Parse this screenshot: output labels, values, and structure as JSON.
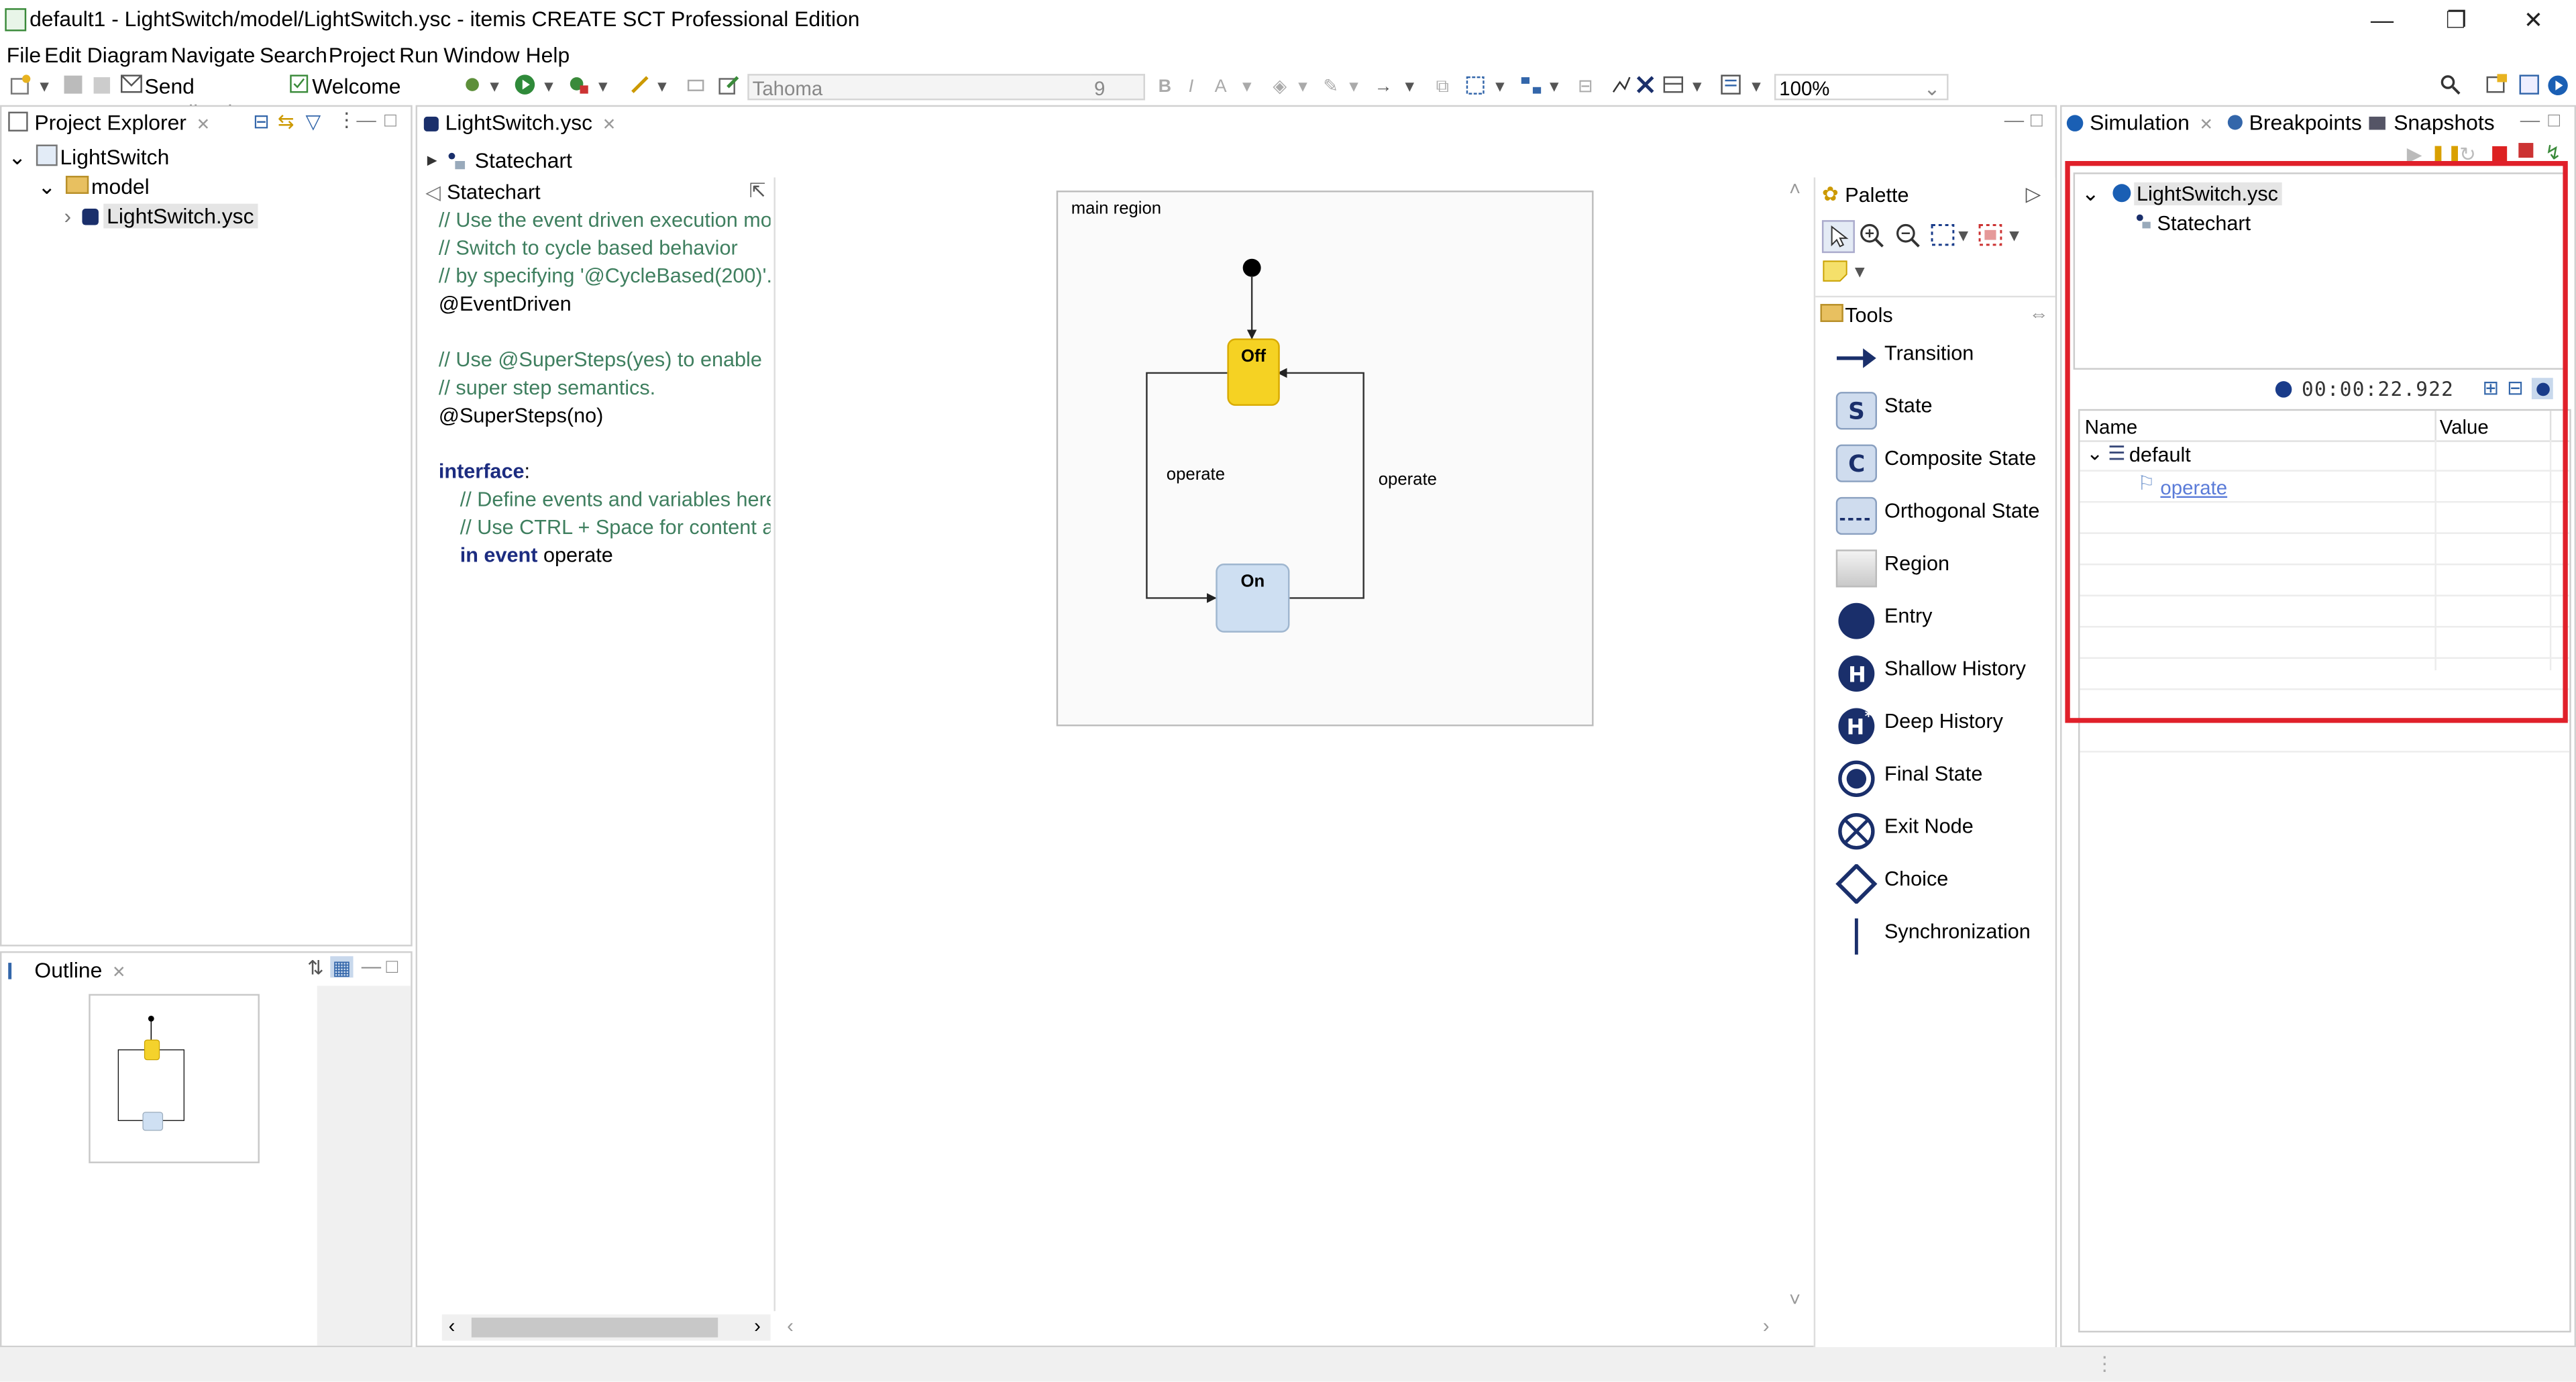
{
  "window": {
    "title": "default1 - LightSwitch/model/LightSwitch.ysc - itemis CREATE SCT Professional Edition",
    "minimize": "—",
    "restore": "❐",
    "close": "✕"
  },
  "menu": [
    "File",
    "Edit",
    "Diagram",
    "Navigate",
    "Search",
    "Project",
    "Run",
    "Window",
    "Help"
  ],
  "toolbar": {
    "send_feedback": "Send Feedback",
    "welcome_page": "Welcome Page",
    "font_name": "Tahoma",
    "font_size": "9",
    "zoom": "100%"
  },
  "project_explorer": {
    "tab": "Project Explorer",
    "tree": [
      {
        "label": "LightSwitch"
      },
      {
        "label": "model"
      },
      {
        "label": "LightSwitch.ysc"
      }
    ]
  },
  "outline": {
    "tab": "Outline"
  },
  "editor": {
    "tab": "LightSwitch.ysc",
    "breadcrumb": "Statechart",
    "definition_header": "Statechart",
    "code": {
      "l1": "// Use the event driven execution mo",
      "l2": "// Switch to cycle based behavior",
      "l3": "// by specifying '@CycleBased(200)'.",
      "l4": "@EventDriven",
      "l5": "// Use @SuperSteps(yes) to enable",
      "l6": "// super step semantics.",
      "l7": "@SuperSteps(no)",
      "l8_kw": "interface",
      "l8_rest": ":",
      "l9": "// Define events and variables here",
      "l10": "// Use CTRL + Space for content as",
      "l11_kw": "in event",
      "l11_rest": " operate"
    },
    "diagram": {
      "region_label": "main region",
      "state_off": "Off",
      "state_on": "On",
      "transition_left": "operate",
      "transition_right": "operate"
    }
  },
  "palette": {
    "title": "Palette",
    "tools_header": "Tools",
    "items": [
      {
        "label": "Transition",
        "icon": "transition-icon"
      },
      {
        "label": "State",
        "icon": "state-icon"
      },
      {
        "label": "Composite State",
        "icon": "composite-state-icon"
      },
      {
        "label": "Orthogonal State",
        "icon": "orthogonal-state-icon"
      },
      {
        "label": "Region",
        "icon": "region-icon"
      },
      {
        "label": "Entry",
        "icon": "entry-icon"
      },
      {
        "label": "Shallow History",
        "icon": "shallow-history-icon"
      },
      {
        "label": "Deep History",
        "icon": "deep-history-icon"
      },
      {
        "label": "Final State",
        "icon": "final-state-icon"
      },
      {
        "label": "Exit Node",
        "icon": "exit-node-icon"
      },
      {
        "label": "Choice",
        "icon": "choice-icon"
      },
      {
        "label": "Synchronization",
        "icon": "synchronization-icon"
      }
    ]
  },
  "simulation": {
    "tabs": [
      "Simulation",
      "Breakpoints",
      "Snapshots"
    ],
    "session_tree": {
      "root": "LightSwitch.ysc",
      "child": "Statechart"
    },
    "timer": "00:00:22.922",
    "table": {
      "col_name": "Name",
      "col_value": "Value",
      "scope": "default",
      "event": "operate"
    },
    "highlight_color": "#e0202a"
  }
}
